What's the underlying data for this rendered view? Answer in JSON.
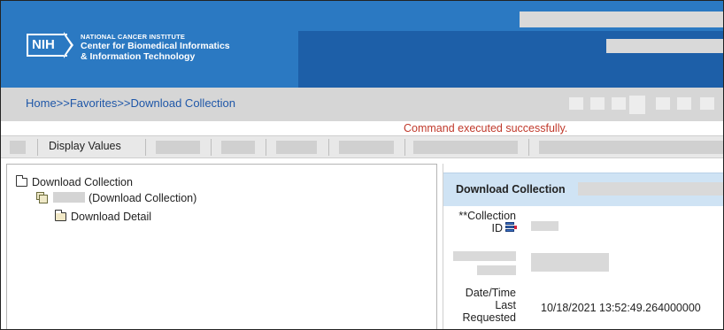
{
  "header": {
    "logo_text": "NIH",
    "org_small": "NATIONAL CANCER INSTITUTE",
    "org_line1": "Center for Biomedical Informatics",
    "org_line2": "& Information Technology"
  },
  "breadcrumb": {
    "text": "Home>>Favorites>>Download Collection"
  },
  "status_message": "Command executed successfully.",
  "toolbar": {
    "display_values_label": "Display Values"
  },
  "tree": {
    "root_label": "Download Collection",
    "child_suffix": "(Download Collection)",
    "detail_label": "Download Detail"
  },
  "detail": {
    "title": "Download Collection",
    "collection_id_label_line1": "**Collection",
    "collection_id_label_line2": "ID",
    "date_label_line1": "Date/Time",
    "date_label_line2": "Last",
    "date_label_line3": "Requested",
    "date_value": "10/18/2021 13:52:49.264000000"
  },
  "colors": {
    "header_blue": "#2b79c2",
    "header_dark_blue": "#1d5fa8",
    "link_blue": "#1f57a8",
    "message_red": "#c0392b",
    "detail_header_bg": "#cfe3f4"
  }
}
